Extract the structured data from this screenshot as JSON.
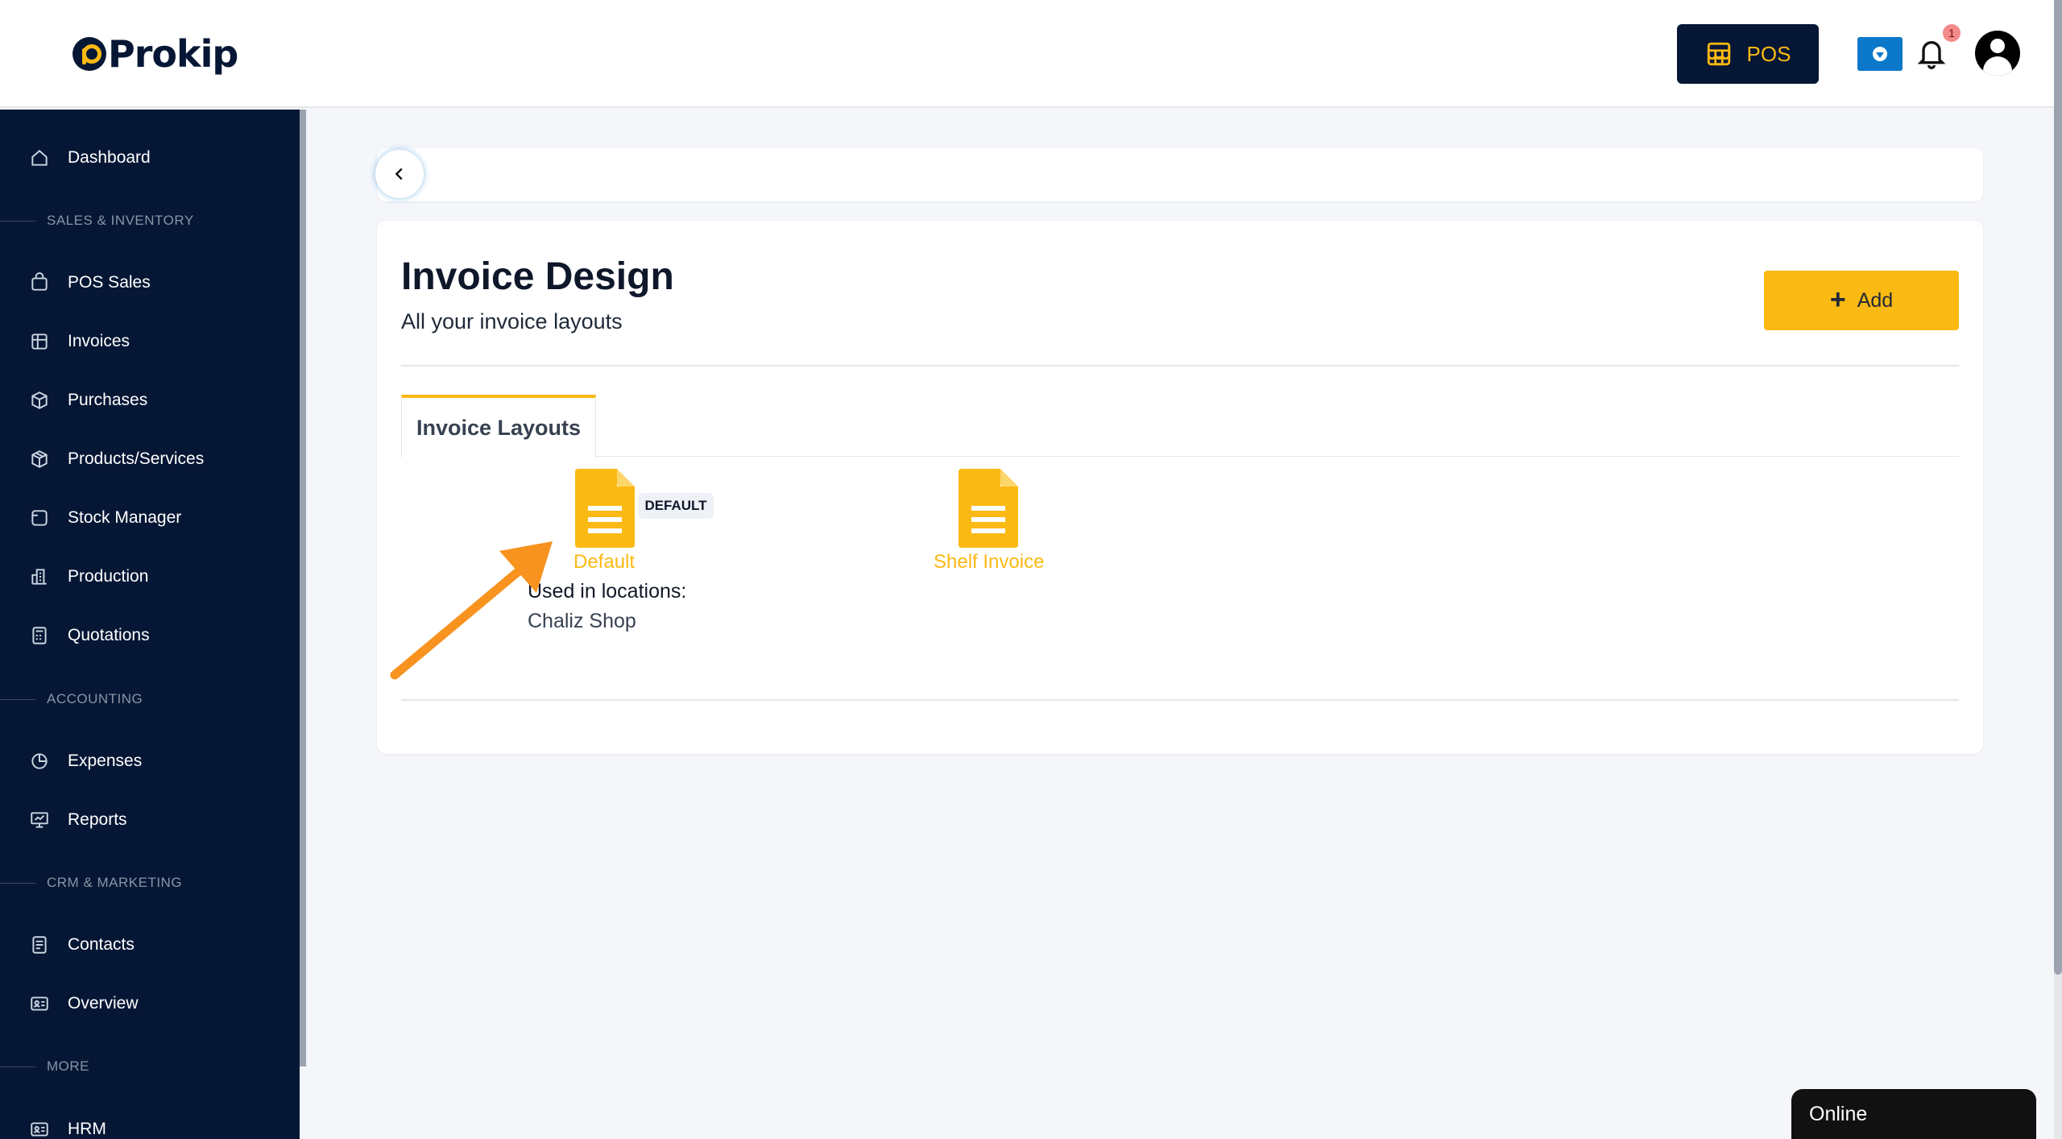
{
  "header": {
    "logo_text": "Prokip",
    "pos_label": "POS",
    "notification_count": "1"
  },
  "sidebar": {
    "items": [
      {
        "label": "Dashboard",
        "icon": "home-icon"
      },
      {
        "section": "SALES & INVENTORY"
      },
      {
        "label": "POS Sales",
        "icon": "bag-icon"
      },
      {
        "label": "Invoices",
        "icon": "invoice-icon"
      },
      {
        "label": "Purchases",
        "icon": "box-icon"
      },
      {
        "label": "Products/Services",
        "icon": "package-icon"
      },
      {
        "label": "Stock Manager",
        "icon": "stock-icon"
      },
      {
        "label": "Production",
        "icon": "factory-icon"
      },
      {
        "label": "Quotations",
        "icon": "calculator-icon"
      },
      {
        "section": "ACCOUNTING"
      },
      {
        "label": "Expenses",
        "icon": "pie-chart-icon"
      },
      {
        "label": "Reports",
        "icon": "presentation-icon"
      },
      {
        "section": "CRM & MARKETING"
      },
      {
        "label": "Contacts",
        "icon": "contacts-icon"
      },
      {
        "label": "Overview",
        "icon": "id-card-icon"
      },
      {
        "section": "MORE"
      },
      {
        "label": "HRM",
        "icon": "id-card-icon"
      }
    ]
  },
  "main": {
    "title": "Invoice Design",
    "subtitle": "All your invoice layouts",
    "add_label": "Add",
    "tab_label": "Invoice Layouts",
    "layouts": [
      {
        "name": "Default",
        "badge": "DEFAULT",
        "used_label": "Used in locations:",
        "used_value": "Chaliz Shop"
      },
      {
        "name": "Shelf Invoice"
      }
    ]
  },
  "status": {
    "online_label": "Online"
  },
  "colors": {
    "brand_navy": "#061735",
    "accent_yellow": "#fbb913",
    "annotation_orange": "#f7931e",
    "download_blue": "#0b78c9"
  }
}
